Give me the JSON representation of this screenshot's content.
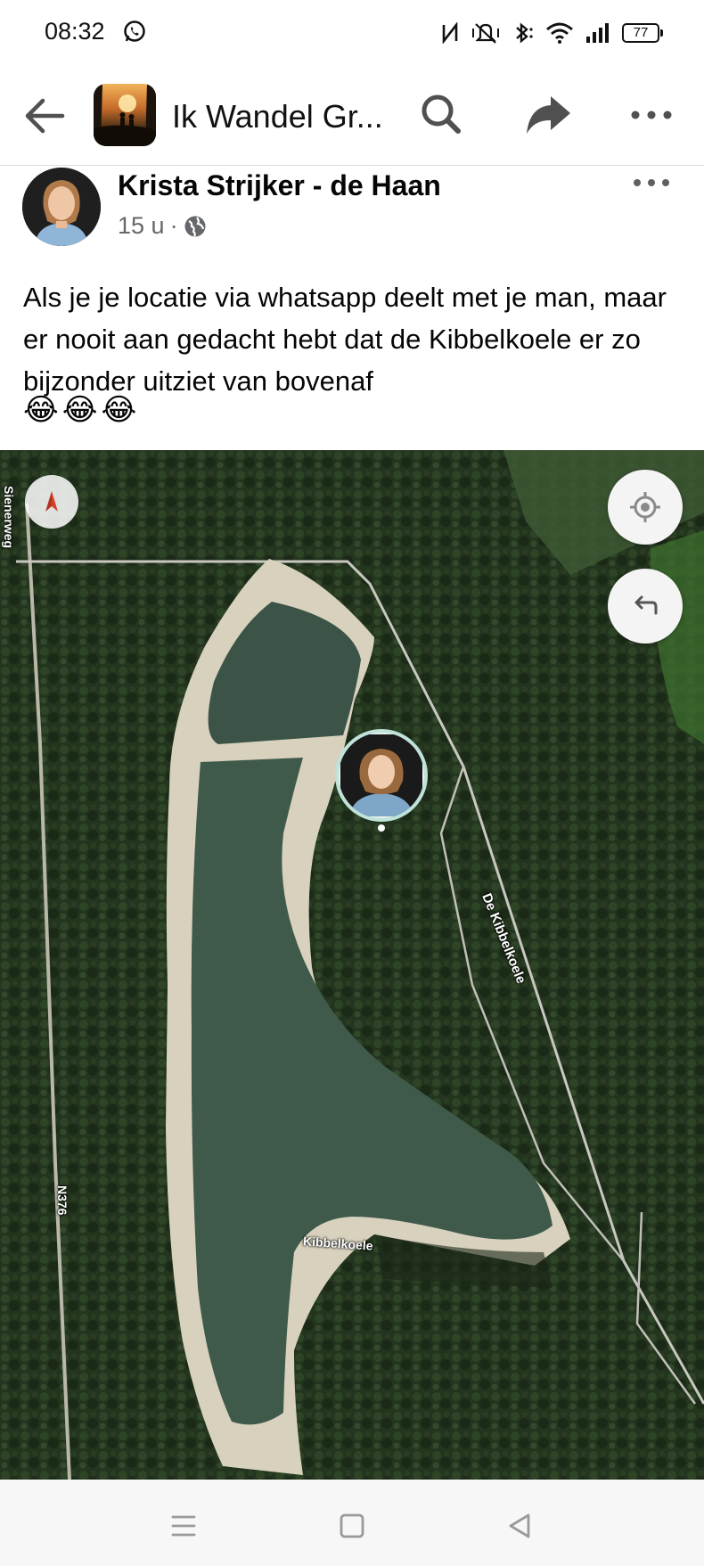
{
  "status_bar": {
    "time": "08:32",
    "battery": "77",
    "icons": [
      "whatsapp-icon",
      "nfc-icon",
      "vibrate-icon",
      "bluetooth-icon",
      "wifi-icon",
      "signal-icon",
      "battery-icon"
    ]
  },
  "header": {
    "group_name": "Ik Wandel Gr...",
    "icons": [
      "back-arrow-icon",
      "search-icon",
      "share-icon",
      "more-icon"
    ]
  },
  "post": {
    "author": "Krista Strijker - de Haan",
    "time": "15 u",
    "separator": "·",
    "audience_icon": "globe-icon",
    "text": "Als je je locatie via whatsapp deelt met je man, maar er nooit aan gedacht hebt dat de Kibbelkoele er zo bijzonder uitziet van bovenaf",
    "emojis": [
      "😂",
      "😂",
      "😂"
    ]
  },
  "map": {
    "labels": {
      "sienerweg": "Sienerweg",
      "n376": "N376",
      "de_kibbelkoele": "De Kibbelkoele",
      "kibbelkoele": "Kibbelkoele"
    },
    "controls": [
      "compass-icon",
      "locate-icon",
      "undo-icon"
    ]
  },
  "nav_bar": {
    "icons": [
      "menu-icon",
      "home-icon",
      "back-triangle-icon"
    ]
  },
  "colors": {
    "forest": "#24361f",
    "water": "#3f5a4a",
    "sand": "#d9d2c0",
    "meta_gray": "#65676b"
  }
}
